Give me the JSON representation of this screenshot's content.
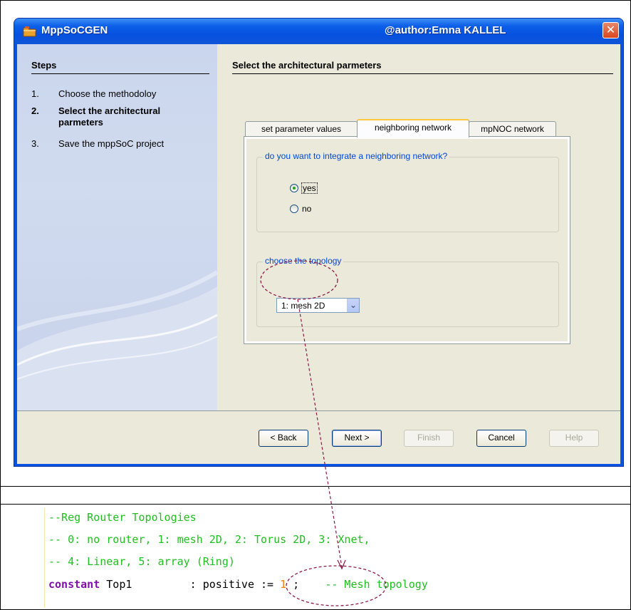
{
  "window": {
    "app_title": "MppSoCGEN",
    "author": "@author:Emna KALLEL",
    "close_glyph": "✕"
  },
  "steps": {
    "heading": "Steps",
    "items": [
      {
        "num": "1.",
        "label": "Choose the methodoloy"
      },
      {
        "num": "2.",
        "label": "Select the architectural parmeters"
      },
      {
        "num": "3.",
        "label": "Save the mppSoC project"
      }
    ]
  },
  "main": {
    "heading": "Select the architectural parmeters",
    "tabs": [
      {
        "label": "set parameter values",
        "active": false
      },
      {
        "label": "neighboring network",
        "active": true
      },
      {
        "label": "mpNOC network",
        "active": false
      }
    ],
    "neighbor_group": {
      "title": "do you want to integrate a neighboring network?",
      "options": [
        {
          "label": "yes",
          "selected": true
        },
        {
          "label": "no",
          "selected": false
        }
      ]
    },
    "topology_group": {
      "title": "choose the topology",
      "selected": "1: mesh 2D"
    }
  },
  "buttons": {
    "back": "< Back",
    "next": "Next >",
    "finish": "Finish",
    "cancel": "Cancel",
    "help": "Help"
  },
  "code": {
    "line1": "--Reg Router Topologies",
    "line2": "-- 0: no router, 1: mesh 2D, 2: Torus 2D, 3: Xnet,",
    "line3": "-- 4: Linear, 5: array (Ring)",
    "line4_kw": "constant",
    "line4_id": " Top1",
    "line4_colon": "         : ",
    "line4_type": "positive := ",
    "line4_val": "1",
    "line4_end": " ;",
    "line4_comment": "    -- Mesh topology"
  },
  "colors": {
    "titlebar": "#0c5ee8",
    "group_title": "#0046d5",
    "comment_green": "#1fbf1f",
    "keyword_purple": "#7f0fa8",
    "number_orange": "#ff7f00",
    "annotation": "#8b1a4a"
  }
}
